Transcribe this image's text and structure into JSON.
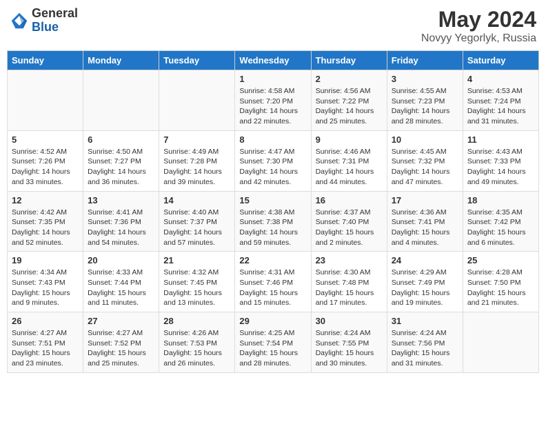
{
  "header": {
    "logo_general": "General",
    "logo_blue": "Blue",
    "title": "May 2024",
    "subtitle": "Novyy Yegorlyk, Russia"
  },
  "weekdays": [
    "Sunday",
    "Monday",
    "Tuesday",
    "Wednesday",
    "Thursday",
    "Friday",
    "Saturday"
  ],
  "weeks": [
    [
      {
        "day": "",
        "sunrise": "",
        "sunset": "",
        "daylight": ""
      },
      {
        "day": "",
        "sunrise": "",
        "sunset": "",
        "daylight": ""
      },
      {
        "day": "",
        "sunrise": "",
        "sunset": "",
        "daylight": ""
      },
      {
        "day": "1",
        "sunrise": "Sunrise: 4:58 AM",
        "sunset": "Sunset: 7:20 PM",
        "daylight": "Daylight: 14 hours and 22 minutes."
      },
      {
        "day": "2",
        "sunrise": "Sunrise: 4:56 AM",
        "sunset": "Sunset: 7:22 PM",
        "daylight": "Daylight: 14 hours and 25 minutes."
      },
      {
        "day": "3",
        "sunrise": "Sunrise: 4:55 AM",
        "sunset": "Sunset: 7:23 PM",
        "daylight": "Daylight: 14 hours and 28 minutes."
      },
      {
        "day": "4",
        "sunrise": "Sunrise: 4:53 AM",
        "sunset": "Sunset: 7:24 PM",
        "daylight": "Daylight: 14 hours and 31 minutes."
      }
    ],
    [
      {
        "day": "5",
        "sunrise": "Sunrise: 4:52 AM",
        "sunset": "Sunset: 7:26 PM",
        "daylight": "Daylight: 14 hours and 33 minutes."
      },
      {
        "day": "6",
        "sunrise": "Sunrise: 4:50 AM",
        "sunset": "Sunset: 7:27 PM",
        "daylight": "Daylight: 14 hours and 36 minutes."
      },
      {
        "day": "7",
        "sunrise": "Sunrise: 4:49 AM",
        "sunset": "Sunset: 7:28 PM",
        "daylight": "Daylight: 14 hours and 39 minutes."
      },
      {
        "day": "8",
        "sunrise": "Sunrise: 4:47 AM",
        "sunset": "Sunset: 7:30 PM",
        "daylight": "Daylight: 14 hours and 42 minutes."
      },
      {
        "day": "9",
        "sunrise": "Sunrise: 4:46 AM",
        "sunset": "Sunset: 7:31 PM",
        "daylight": "Daylight: 14 hours and 44 minutes."
      },
      {
        "day": "10",
        "sunrise": "Sunrise: 4:45 AM",
        "sunset": "Sunset: 7:32 PM",
        "daylight": "Daylight: 14 hours and 47 minutes."
      },
      {
        "day": "11",
        "sunrise": "Sunrise: 4:43 AM",
        "sunset": "Sunset: 7:33 PM",
        "daylight": "Daylight: 14 hours and 49 minutes."
      }
    ],
    [
      {
        "day": "12",
        "sunrise": "Sunrise: 4:42 AM",
        "sunset": "Sunset: 7:35 PM",
        "daylight": "Daylight: 14 hours and 52 minutes."
      },
      {
        "day": "13",
        "sunrise": "Sunrise: 4:41 AM",
        "sunset": "Sunset: 7:36 PM",
        "daylight": "Daylight: 14 hours and 54 minutes."
      },
      {
        "day": "14",
        "sunrise": "Sunrise: 4:40 AM",
        "sunset": "Sunset: 7:37 PM",
        "daylight": "Daylight: 14 hours and 57 minutes."
      },
      {
        "day": "15",
        "sunrise": "Sunrise: 4:38 AM",
        "sunset": "Sunset: 7:38 PM",
        "daylight": "Daylight: 14 hours and 59 minutes."
      },
      {
        "day": "16",
        "sunrise": "Sunrise: 4:37 AM",
        "sunset": "Sunset: 7:40 PM",
        "daylight": "Daylight: 15 hours and 2 minutes."
      },
      {
        "day": "17",
        "sunrise": "Sunrise: 4:36 AM",
        "sunset": "Sunset: 7:41 PM",
        "daylight": "Daylight: 15 hours and 4 minutes."
      },
      {
        "day": "18",
        "sunrise": "Sunrise: 4:35 AM",
        "sunset": "Sunset: 7:42 PM",
        "daylight": "Daylight: 15 hours and 6 minutes."
      }
    ],
    [
      {
        "day": "19",
        "sunrise": "Sunrise: 4:34 AM",
        "sunset": "Sunset: 7:43 PM",
        "daylight": "Daylight: 15 hours and 9 minutes."
      },
      {
        "day": "20",
        "sunrise": "Sunrise: 4:33 AM",
        "sunset": "Sunset: 7:44 PM",
        "daylight": "Daylight: 15 hours and 11 minutes."
      },
      {
        "day": "21",
        "sunrise": "Sunrise: 4:32 AM",
        "sunset": "Sunset: 7:45 PM",
        "daylight": "Daylight: 15 hours and 13 minutes."
      },
      {
        "day": "22",
        "sunrise": "Sunrise: 4:31 AM",
        "sunset": "Sunset: 7:46 PM",
        "daylight": "Daylight: 15 hours and 15 minutes."
      },
      {
        "day": "23",
        "sunrise": "Sunrise: 4:30 AM",
        "sunset": "Sunset: 7:48 PM",
        "daylight": "Daylight: 15 hours and 17 minutes."
      },
      {
        "day": "24",
        "sunrise": "Sunrise: 4:29 AM",
        "sunset": "Sunset: 7:49 PM",
        "daylight": "Daylight: 15 hours and 19 minutes."
      },
      {
        "day": "25",
        "sunrise": "Sunrise: 4:28 AM",
        "sunset": "Sunset: 7:50 PM",
        "daylight": "Daylight: 15 hours and 21 minutes."
      }
    ],
    [
      {
        "day": "26",
        "sunrise": "Sunrise: 4:27 AM",
        "sunset": "Sunset: 7:51 PM",
        "daylight": "Daylight: 15 hours and 23 minutes."
      },
      {
        "day": "27",
        "sunrise": "Sunrise: 4:27 AM",
        "sunset": "Sunset: 7:52 PM",
        "daylight": "Daylight: 15 hours and 25 minutes."
      },
      {
        "day": "28",
        "sunrise": "Sunrise: 4:26 AM",
        "sunset": "Sunset: 7:53 PM",
        "daylight": "Daylight: 15 hours and 26 minutes."
      },
      {
        "day": "29",
        "sunrise": "Sunrise: 4:25 AM",
        "sunset": "Sunset: 7:54 PM",
        "daylight": "Daylight: 15 hours and 28 minutes."
      },
      {
        "day": "30",
        "sunrise": "Sunrise: 4:24 AM",
        "sunset": "Sunset: 7:55 PM",
        "daylight": "Daylight: 15 hours and 30 minutes."
      },
      {
        "day": "31",
        "sunrise": "Sunrise: 4:24 AM",
        "sunset": "Sunset: 7:56 PM",
        "daylight": "Daylight: 15 hours and 31 minutes."
      },
      {
        "day": "",
        "sunrise": "",
        "sunset": "",
        "daylight": ""
      }
    ]
  ]
}
